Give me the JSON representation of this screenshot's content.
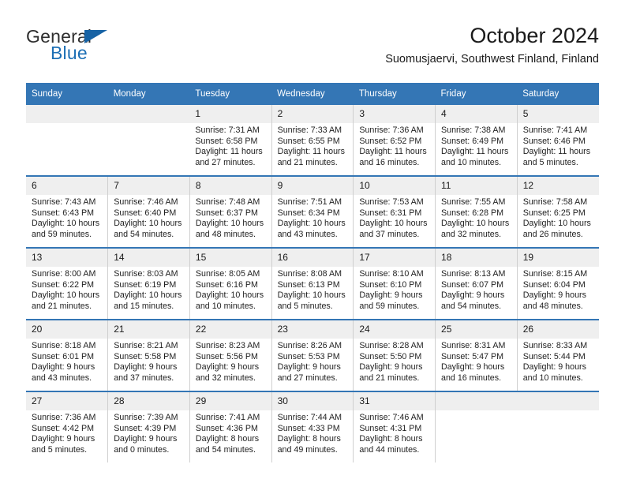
{
  "brand": {
    "name_primary": "General",
    "name_secondary": "Blue",
    "accent_color": "#1763a5"
  },
  "header": {
    "title": "October 2024",
    "subtitle": "Suomusjaervi, Southwest Finland, Finland"
  },
  "theme": {
    "header_row_bg": "#3476b5",
    "daynum_bg": "#efefef",
    "text_color": "#1a1a1a"
  },
  "calendar": {
    "weekday_headers": [
      "Sunday",
      "Monday",
      "Tuesday",
      "Wednesday",
      "Thursday",
      "Friday",
      "Saturday"
    ],
    "labels": {
      "sunrise": "Sunrise:",
      "sunset": "Sunset:",
      "daylight": "Daylight:"
    },
    "weeks": [
      [
        {
          "day": "",
          "empty": true
        },
        {
          "day": "",
          "empty": true
        },
        {
          "day": "1",
          "sunrise": "Sunrise: 7:31 AM",
          "sunset": "Sunset: 6:58 PM",
          "daylight": "Daylight: 11 hours and 27 minutes."
        },
        {
          "day": "2",
          "sunrise": "Sunrise: 7:33 AM",
          "sunset": "Sunset: 6:55 PM",
          "daylight": "Daylight: 11 hours and 21 minutes."
        },
        {
          "day": "3",
          "sunrise": "Sunrise: 7:36 AM",
          "sunset": "Sunset: 6:52 PM",
          "daylight": "Daylight: 11 hours and 16 minutes."
        },
        {
          "day": "4",
          "sunrise": "Sunrise: 7:38 AM",
          "sunset": "Sunset: 6:49 PM",
          "daylight": "Daylight: 11 hours and 10 minutes."
        },
        {
          "day": "5",
          "sunrise": "Sunrise: 7:41 AM",
          "sunset": "Sunset: 6:46 PM",
          "daylight": "Daylight: 11 hours and 5 minutes."
        }
      ],
      [
        {
          "day": "6",
          "sunrise": "Sunrise: 7:43 AM",
          "sunset": "Sunset: 6:43 PM",
          "daylight": "Daylight: 10 hours and 59 minutes."
        },
        {
          "day": "7",
          "sunrise": "Sunrise: 7:46 AM",
          "sunset": "Sunset: 6:40 PM",
          "daylight": "Daylight: 10 hours and 54 minutes."
        },
        {
          "day": "8",
          "sunrise": "Sunrise: 7:48 AM",
          "sunset": "Sunset: 6:37 PM",
          "daylight": "Daylight: 10 hours and 48 minutes."
        },
        {
          "day": "9",
          "sunrise": "Sunrise: 7:51 AM",
          "sunset": "Sunset: 6:34 PM",
          "daylight": "Daylight: 10 hours and 43 minutes."
        },
        {
          "day": "10",
          "sunrise": "Sunrise: 7:53 AM",
          "sunset": "Sunset: 6:31 PM",
          "daylight": "Daylight: 10 hours and 37 minutes."
        },
        {
          "day": "11",
          "sunrise": "Sunrise: 7:55 AM",
          "sunset": "Sunset: 6:28 PM",
          "daylight": "Daylight: 10 hours and 32 minutes."
        },
        {
          "day": "12",
          "sunrise": "Sunrise: 7:58 AM",
          "sunset": "Sunset: 6:25 PM",
          "daylight": "Daylight: 10 hours and 26 minutes."
        }
      ],
      [
        {
          "day": "13",
          "sunrise": "Sunrise: 8:00 AM",
          "sunset": "Sunset: 6:22 PM",
          "daylight": "Daylight: 10 hours and 21 minutes."
        },
        {
          "day": "14",
          "sunrise": "Sunrise: 8:03 AM",
          "sunset": "Sunset: 6:19 PM",
          "daylight": "Daylight: 10 hours and 15 minutes."
        },
        {
          "day": "15",
          "sunrise": "Sunrise: 8:05 AM",
          "sunset": "Sunset: 6:16 PM",
          "daylight": "Daylight: 10 hours and 10 minutes."
        },
        {
          "day": "16",
          "sunrise": "Sunrise: 8:08 AM",
          "sunset": "Sunset: 6:13 PM",
          "daylight": "Daylight: 10 hours and 5 minutes."
        },
        {
          "day": "17",
          "sunrise": "Sunrise: 8:10 AM",
          "sunset": "Sunset: 6:10 PM",
          "daylight": "Daylight: 9 hours and 59 minutes."
        },
        {
          "day": "18",
          "sunrise": "Sunrise: 8:13 AM",
          "sunset": "Sunset: 6:07 PM",
          "daylight": "Daylight: 9 hours and 54 minutes."
        },
        {
          "day": "19",
          "sunrise": "Sunrise: 8:15 AM",
          "sunset": "Sunset: 6:04 PM",
          "daylight": "Daylight: 9 hours and 48 minutes."
        }
      ],
      [
        {
          "day": "20",
          "sunrise": "Sunrise: 8:18 AM",
          "sunset": "Sunset: 6:01 PM",
          "daylight": "Daylight: 9 hours and 43 minutes."
        },
        {
          "day": "21",
          "sunrise": "Sunrise: 8:21 AM",
          "sunset": "Sunset: 5:58 PM",
          "daylight": "Daylight: 9 hours and 37 minutes."
        },
        {
          "day": "22",
          "sunrise": "Sunrise: 8:23 AM",
          "sunset": "Sunset: 5:56 PM",
          "daylight": "Daylight: 9 hours and 32 minutes."
        },
        {
          "day": "23",
          "sunrise": "Sunrise: 8:26 AM",
          "sunset": "Sunset: 5:53 PM",
          "daylight": "Daylight: 9 hours and 27 minutes."
        },
        {
          "day": "24",
          "sunrise": "Sunrise: 8:28 AM",
          "sunset": "Sunset: 5:50 PM",
          "daylight": "Daylight: 9 hours and 21 minutes."
        },
        {
          "day": "25",
          "sunrise": "Sunrise: 8:31 AM",
          "sunset": "Sunset: 5:47 PM",
          "daylight": "Daylight: 9 hours and 16 minutes."
        },
        {
          "day": "26",
          "sunrise": "Sunrise: 8:33 AM",
          "sunset": "Sunset: 5:44 PM",
          "daylight": "Daylight: 9 hours and 10 minutes."
        }
      ],
      [
        {
          "day": "27",
          "sunrise": "Sunrise: 7:36 AM",
          "sunset": "Sunset: 4:42 PM",
          "daylight": "Daylight: 9 hours and 5 minutes."
        },
        {
          "day": "28",
          "sunrise": "Sunrise: 7:39 AM",
          "sunset": "Sunset: 4:39 PM",
          "daylight": "Daylight: 9 hours and 0 minutes."
        },
        {
          "day": "29",
          "sunrise": "Sunrise: 7:41 AM",
          "sunset": "Sunset: 4:36 PM",
          "daylight": "Daylight: 8 hours and 54 minutes."
        },
        {
          "day": "30",
          "sunrise": "Sunrise: 7:44 AM",
          "sunset": "Sunset: 4:33 PM",
          "daylight": "Daylight: 8 hours and 49 minutes."
        },
        {
          "day": "31",
          "sunrise": "Sunrise: 7:46 AM",
          "sunset": "Sunset: 4:31 PM",
          "daylight": "Daylight: 8 hours and 44 minutes."
        },
        {
          "day": "",
          "empty": true
        },
        {
          "day": "",
          "empty": true
        }
      ]
    ]
  }
}
